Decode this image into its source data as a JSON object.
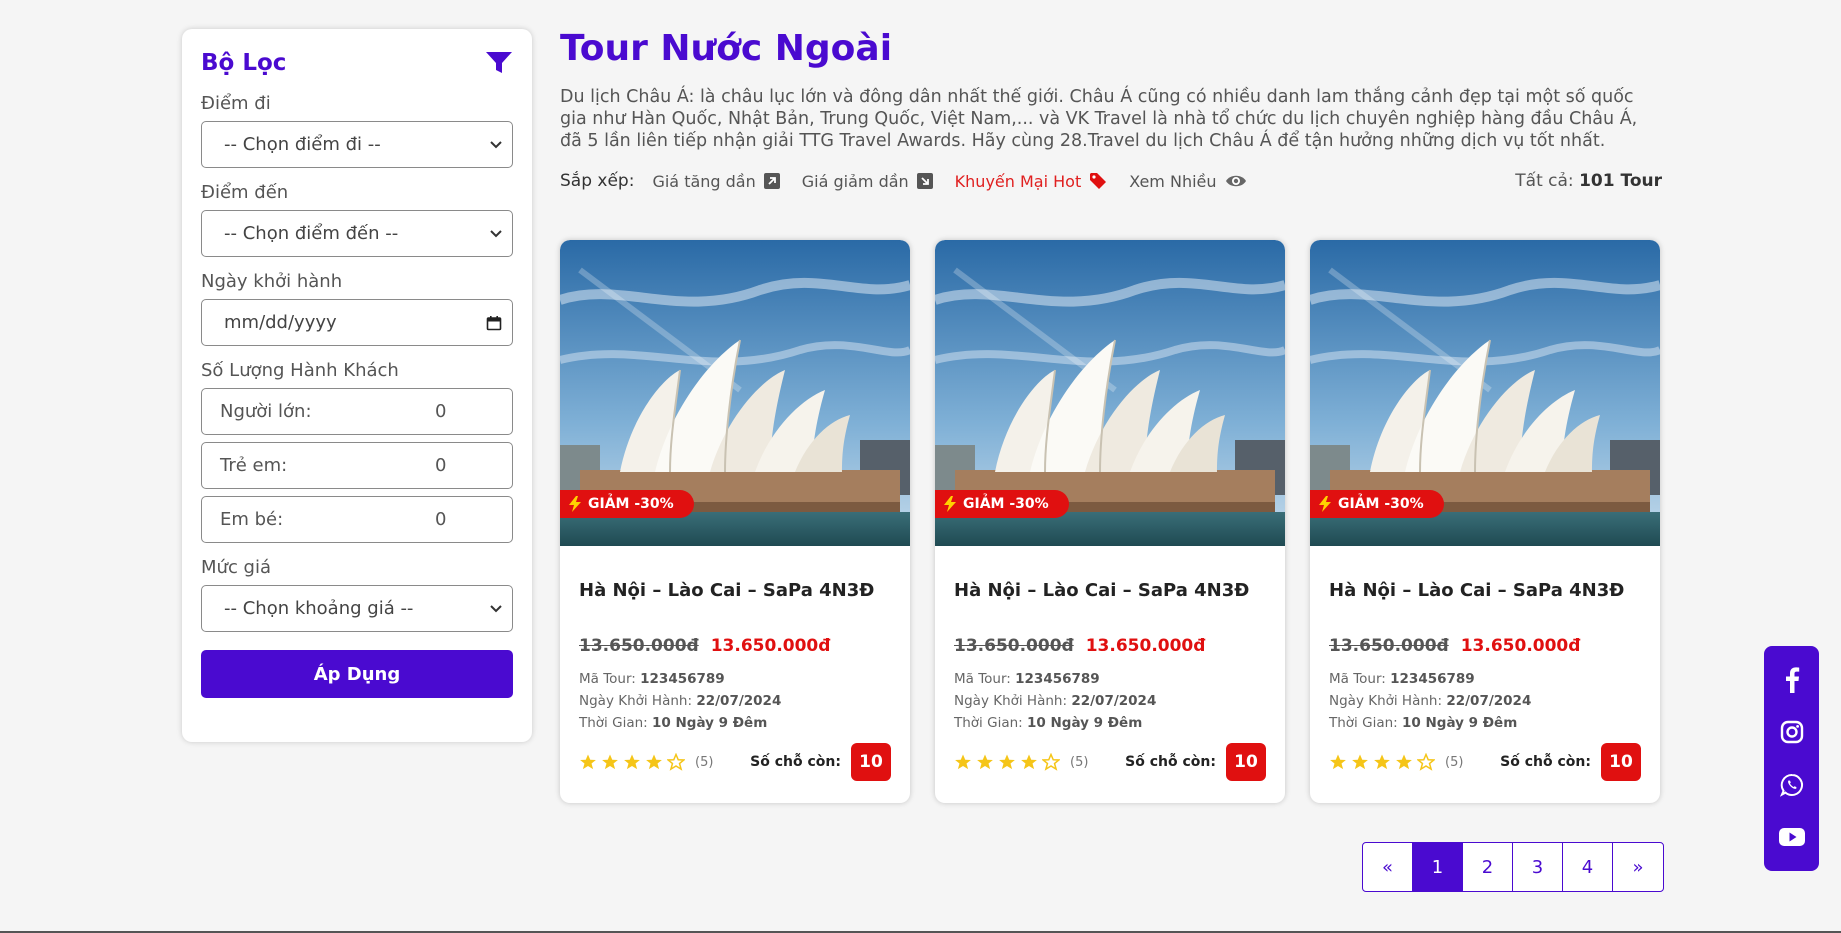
{
  "filter": {
    "title": "Bộ Lọc",
    "departure_label": "Điểm đi",
    "departure_value": "-- Chọn điểm đi --",
    "destination_label": "Điểm đến",
    "destination_value": "-- Chọn điểm đến --",
    "date_label": "Ngày khởi hành",
    "date_placeholder": "mm/dd/yyyy",
    "passengers_label": "Số Lượng Hành Khách",
    "adults_label": "Người lớn:",
    "adults_value": "0",
    "children_label": "Trẻ em:",
    "children_value": "0",
    "infants_label": "Em bé:",
    "infants_value": "0",
    "price_label": "Mức giá",
    "price_value": "-- Chọn khoảng giá --",
    "apply_label": "Áp Dụng"
  },
  "main": {
    "title": "Tour Nước Ngoài",
    "description": "Du lịch Châu Á: là châu lục lớn và đông dân nhất thế giới. Châu Á cũng có nhiều danh lam thắng cảnh đẹp tại một số quốc gia như Hàn Quốc, Nhật Bản, Trung Quốc, Việt Nam,... và VK Travel là nhà tổ chức du lịch chuyên nghiệp hàng đầu Châu Á, đã 5 lần liên tiếp nhận giải TTG Travel Awards. Hãy cùng 28.Travel du lịch Châu Á để tận hưởng những dịch vụ tốt nhất.",
    "sort_label": "Sắp xếp:",
    "sort_options": [
      "Giá tăng dần",
      "Giá giảm dần",
      "Khuyến Mại Hot",
      "Xem Nhiều"
    ],
    "total_prefix": "Tất cả:",
    "total_value": "101 Tour"
  },
  "cards": [
    {
      "badge": "GIẢM -30%",
      "title": "Hà Nội – Lào Cai – SaPa 4N3Đ",
      "old_price": "13.650.000đ",
      "new_price": "13.650.000đ",
      "code_label": "Mã Tour:",
      "code": "123456789",
      "date_label": "Ngày Khởi Hành:",
      "date": "22/07/2024",
      "duration_label": "Thời Gian:",
      "duration": "10 Ngày 9 Đêm",
      "rating": 4,
      "rating_count": "(5)",
      "seats_label": "Số chỗ còn:",
      "seats": "10"
    },
    {
      "badge": "GIẢM -30%",
      "title": "Hà Nội – Lào Cai – SaPa 4N3Đ",
      "old_price": "13.650.000đ",
      "new_price": "13.650.000đ",
      "code_label": "Mã Tour:",
      "code": "123456789",
      "date_label": "Ngày Khởi Hành:",
      "date": "22/07/2024",
      "duration_label": "Thời Gian:",
      "duration": "10 Ngày 9 Đêm",
      "rating": 4,
      "rating_count": "(5)",
      "seats_label": "Số chỗ còn:",
      "seats": "10"
    },
    {
      "badge": "GIẢM -30%",
      "title": "Hà Nội – Lào Cai – SaPa 4N3Đ",
      "old_price": "13.650.000đ",
      "new_price": "13.650.000đ",
      "code_label": "Mã Tour:",
      "code": "123456789",
      "date_label": "Ngày Khởi Hành:",
      "date": "22/07/2024",
      "duration_label": "Thời Gian:",
      "duration": "10 Ngày 9 Đêm",
      "rating": 4,
      "rating_count": "(5)",
      "seats_label": "Số chỗ còn:",
      "seats": "10"
    }
  ],
  "pagination": {
    "prev": "«",
    "pages": [
      "1",
      "2",
      "3",
      "4"
    ],
    "active": "1",
    "next": "»"
  },
  "social": [
    "facebook-icon",
    "instagram-icon",
    "whatsapp-icon",
    "youtube-icon"
  ],
  "colors": {
    "brand": "#4a0ad0",
    "accent_red": "#e01010",
    "star": "#f5c518",
    "background": "#f5f5f5"
  }
}
